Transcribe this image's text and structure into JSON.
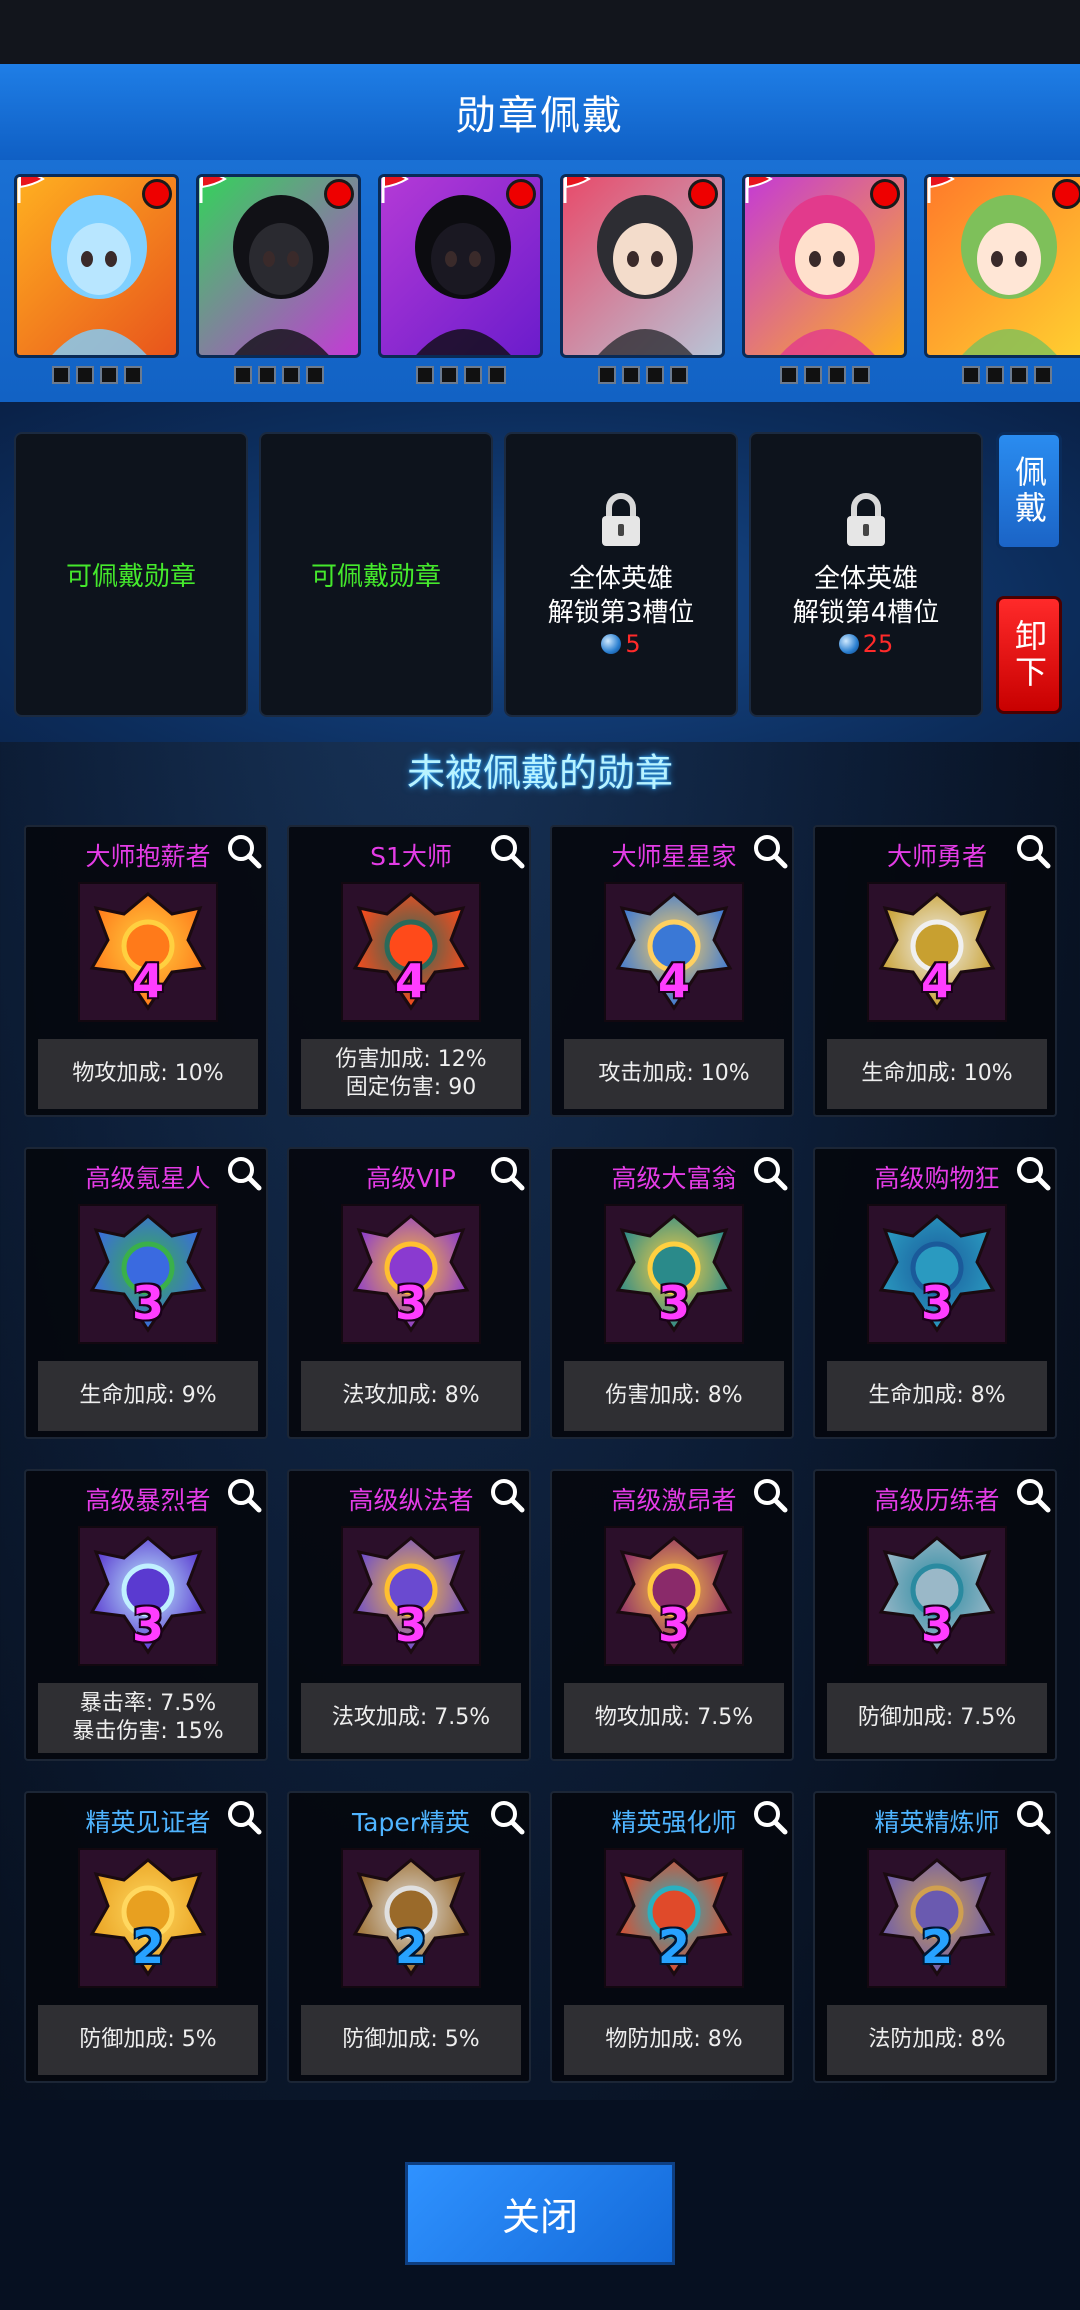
{
  "header": {
    "title": "勋章佩戴"
  },
  "heroes": [
    {
      "name": "hero-1",
      "bg": [
        "#ffb020",
        "#e8541c"
      ],
      "face": "#b8e6ff",
      "hair": "#7fd0ff"
    },
    {
      "name": "hero-2",
      "bg": [
        "#33d35a",
        "#c43ad6"
      ],
      "face": "#2a2a30",
      "hair": "#111116"
    },
    {
      "name": "hero-3",
      "bg": [
        "#b43ad6",
        "#6b1ccc"
      ],
      "face": "#1a1822",
      "hair": "#0c0c10"
    },
    {
      "name": "hero-4",
      "bg": [
        "#e84a6a",
        "#b8c4d6"
      ],
      "face": "#f3dccb",
      "hair": "#2d2d33"
    },
    {
      "name": "hero-5",
      "bg": [
        "#c43ad6",
        "#ffb020"
      ],
      "face": "#ffe0cc",
      "hair": "#e23a8c"
    },
    {
      "name": "hero-6",
      "bg": [
        "#ff7a2a",
        "#ffd030"
      ],
      "face": "#ffe6d6",
      "hair": "#7ec05a"
    }
  ],
  "slots": [
    {
      "type": "open",
      "label": "可佩戴勋章"
    },
    {
      "type": "open",
      "label": "可佩戴勋章"
    },
    {
      "type": "locked",
      "line1": "全体英雄",
      "line2": "解锁第3槽位",
      "cost": "5"
    },
    {
      "type": "locked",
      "line1": "全体英雄",
      "line2": "解锁第4槽位",
      "cost": "25"
    }
  ],
  "buttons": {
    "equip": "佩戴",
    "unequip": "卸下",
    "close": "关闭"
  },
  "section": {
    "title": "未被佩戴的勋章"
  },
  "medals": [
    {
      "name": "大师抱薪者",
      "level": "4",
      "stats": [
        "物攻加成: 10%"
      ],
      "color": "#e43ce6",
      "c1": "#ff7a1a",
      "c2": "#ffd040",
      "rank": 4
    },
    {
      "name": "S1大师",
      "level": "4",
      "stats": [
        "伤害加成: 12%",
        "固定伤害: 90"
      ],
      "color": "#e43ce6",
      "c1": "#ff4a1a",
      "c2": "#2a6a5a",
      "rank": 4
    },
    {
      "name": "大师星星家",
      "level": "4",
      "stats": [
        "攻击加成: 10%"
      ],
      "color": "#e43ce6",
      "c1": "#3a78d6",
      "c2": "#ffd060",
      "rank": 4
    },
    {
      "name": "大师勇者",
      "level": "4",
      "stats": [
        "生命加成: 10%"
      ],
      "color": "#e43ce6",
      "c1": "#c8a030",
      "c2": "#f0f0f0",
      "rank": 4
    },
    {
      "name": "高级氪星人",
      "level": "3",
      "stats": [
        "生命加成: 9%"
      ],
      "color": "#e43ce6",
      "c1": "#3a6ae0",
      "c2": "#3ab04a",
      "rank": 3
    },
    {
      "name": "高级VIP",
      "level": "3",
      "stats": [
        "法攻加成: 8%"
      ],
      "color": "#e43ce6",
      "c1": "#8a3ad0",
      "c2": "#ffc030",
      "rank": 3
    },
    {
      "name": "高级大富翁",
      "level": "3",
      "stats": [
        "伤害加成: 8%"
      ],
      "color": "#e43ce6",
      "c1": "#2a8a8a",
      "c2": "#ffd040",
      "rank": 3
    },
    {
      "name": "高级购物狂",
      "level": "3",
      "stats": [
        "生命加成: 8%"
      ],
      "color": "#e43ce6",
      "c1": "#2a9ac0",
      "c2": "#1a5a9a",
      "rank": 3
    },
    {
      "name": "高级暴烈者",
      "level": "3",
      "stats": [
        "暴击率: 7.5%",
        "暴击伤害:  15%"
      ],
      "color": "#e43ce6",
      "c1": "#5a3ad0",
      "c2": "#c0f0ff",
      "rank": 3
    },
    {
      "name": "高级纵法者",
      "level": "3",
      "stats": [
        "法攻加成: 7.5%"
      ],
      "color": "#e43ce6",
      "c1": "#6a4ad0",
      "c2": "#ffc030",
      "rank": 3
    },
    {
      "name": "高级激昂者",
      "level": "3",
      "stats": [
        "物攻加成: 7.5%"
      ],
      "color": "#e43ce6",
      "c1": "#8a2a6a",
      "c2": "#ffc840",
      "rank": 3
    },
    {
      "name": "高级历练者",
      "level": "3",
      "stats": [
        "防御加成: 7.5%"
      ],
      "color": "#e43ce6",
      "c1": "#9ab8c8",
      "c2": "#2a8aa0",
      "rank": 3
    },
    {
      "name": "精英见证者",
      "level": "2",
      "stats": [
        "防御加成: 5%"
      ],
      "color": "#4fb4ff",
      "c1": "#e8a020",
      "c2": "#ffd860",
      "rank": 2
    },
    {
      "name": "Taper精英",
      "level": "2",
      "stats": [
        "防御加成: 5%"
      ],
      "color": "#4fb4ff",
      "c1": "#9a6a2a",
      "c2": "#e0e0e0",
      "rank": 2
    },
    {
      "name": "精英强化师",
      "level": "2",
      "stats": [
        "物防加成: 8%"
      ],
      "color": "#4fb4ff",
      "c1": "#e04a2a",
      "c2": "#2ab0c0",
      "rank": 2
    },
    {
      "name": "精英精炼师",
      "level": "2",
      "stats": [
        "法防加成: 8%"
      ],
      "color": "#4fb4ff",
      "c1": "#6a5ab0",
      "c2": "#d0a050",
      "rank": 2
    }
  ]
}
